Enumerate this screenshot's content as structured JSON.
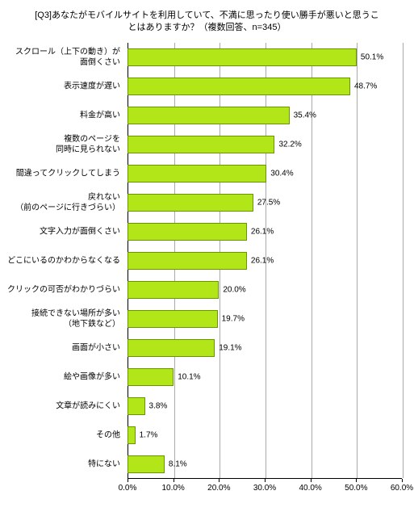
{
  "chart_data": {
    "type": "bar",
    "orientation": "horizontal",
    "title": "[Q3]あなたがモバイルサイトを利用していて、不満に思ったり使い勝手が悪いと思うことはありますか？（複数回答、n=345）",
    "xlabel": "",
    "ylabel": "",
    "xlim": [
      0,
      60
    ],
    "xticks": [
      0,
      10,
      20,
      30,
      40,
      50,
      60
    ],
    "xtick_labels": [
      "0.0%",
      "10.0%",
      "20.0%",
      "30.0%",
      "40.0%",
      "50.0%",
      "60.0%"
    ],
    "categories": [
      "スクロール（上下の動き）が面倒くさい",
      "表示速度が遅い",
      "料金が高い",
      "複数のページを同時に見られない",
      "間違ってクリックしてしまう",
      "戻れない（前のページに行きづらい）",
      "文字入力が面倒くさい",
      "どこにいるのかわからなくなる",
      "クリックの可否がわかりづらい",
      "接続できない場所が多い（地下鉄など）",
      "画面が小さい",
      "絵や画像が多い",
      "文章が読みにくい",
      "その他",
      "特にない"
    ],
    "category_display": [
      "スクロール（上下の動き）が<br>面倒くさい",
      "表示速度が遅い",
      "料金が高い",
      "複数のページを<br>同時に見られない",
      "間違ってクリックしてしまう",
      "戻れない<br>（前のページに行きづらい）",
      "文字入力が面倒くさい",
      "どこにいるのかわからなくなる",
      "クリックの可否がわかりづらい",
      "接続できない場所が多い<br>（地下鉄など）",
      "画面が小さい",
      "絵や画像が多い",
      "文章が読みにくい",
      "その他",
      "特にない"
    ],
    "values": [
      50.1,
      48.7,
      35.4,
      32.2,
      30.4,
      27.5,
      26.1,
      26.1,
      20.0,
      19.7,
      19.1,
      10.1,
      3.8,
      1.7,
      8.1
    ],
    "value_labels": [
      "50.1%",
      "48.7%",
      "35.4%",
      "32.2%",
      "30.4%",
      "27.5%",
      "26.1%",
      "26.1%",
      "20.0%",
      "19.7%",
      "19.1%",
      "10.1%",
      "3.8%",
      "1.7%",
      "8.1%"
    ],
    "bar_color": "#b3e619",
    "bar_border": "#669900"
  }
}
